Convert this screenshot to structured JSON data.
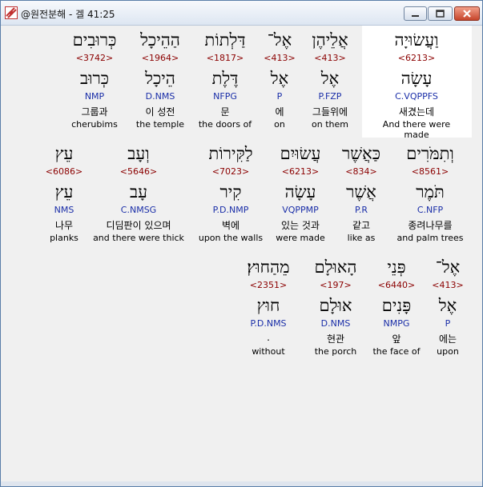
{
  "window": {
    "title": "@원전분해 - 겔 41:25"
  },
  "rows": [
    [
      {
        "heb": "וַעֲשׂוּיָה",
        "strong": "<6213>",
        "lemma": "עָשָׂה",
        "parse": "C.VQPPFS",
        "kor": "새겼는데",
        "eng": "And there were made"
      },
      {
        "heb": "אֲלֵיהֶן",
        "strong": "<413>",
        "lemma": "אֶל",
        "parse": "P.FZP",
        "kor": "그들위에",
        "eng": "on them"
      },
      {
        "heb": "אֶל־",
        "strong": "<413>",
        "lemma": "אֶל",
        "parse": "P",
        "kor": "에",
        "eng": "on"
      },
      {
        "heb": "דַּלְתוֹת",
        "strong": "<1817>",
        "lemma": "דֶּלֶת",
        "parse": "NFPG",
        "kor": "문",
        "eng": "the doors of"
      },
      {
        "heb": "הַהֵיכָל",
        "strong": "<1964>",
        "lemma": "הֵיכָל",
        "parse": "D.NMS",
        "kor": "이 성전",
        "eng": "the temple"
      },
      {
        "heb": "כְּרוּבִים",
        "strong": "<3742>",
        "lemma": "כְּרוּב",
        "parse": "NMP",
        "kor": "그룹과",
        "eng": "cherubims"
      }
    ],
    [
      {
        "heb": "וְתִמֹּרִים",
        "strong": "<8561>",
        "lemma": "תֹּמֶר",
        "parse": "C.NFP",
        "kor": "종려나무를",
        "eng": "and palm trees"
      },
      {
        "heb": "כַּאֲשֶׁר",
        "strong": "<834>",
        "lemma": "אֲשֶׁר",
        "parse": "P.R",
        "kor": "같고",
        "eng": "like as"
      },
      {
        "heb": "עֲשׂוּיִם",
        "strong": "<6213>",
        "lemma": "עָשָׂה",
        "parse": "VQPPMP",
        "kor": "있는 것과",
        "eng": "were made"
      },
      {
        "heb": "לַקִּירוֹת",
        "strong": "<7023>",
        "lemma": "קִיר",
        "parse": "P.D.NMP",
        "kor": "벽에",
        "eng": "upon the walls"
      },
      {
        "heb": "וְעָב",
        "strong": "<5646>",
        "lemma": "עָב",
        "parse": "C.NMSG",
        "kor": "디딤판이 있으며",
        "eng": "and there were thick"
      },
      {
        "heb": "עֵץ",
        "strong": "<6086>",
        "lemma": "עֵץ",
        "parse": "NMS",
        "kor": "나무",
        "eng": "planks"
      }
    ],
    [
      {
        "heb": "אֶל־",
        "strong": "<413>",
        "lemma": "אֶל",
        "parse": "P",
        "kor": "에는",
        "eng": "upon"
      },
      {
        "heb": "פְּנֵי",
        "strong": "<6440>",
        "lemma": "פָּנִים",
        "parse": "NMPG",
        "kor": "앞",
        "eng": "the face of"
      },
      {
        "heb": "הָאוּלָם",
        "strong": "<197>",
        "lemma": "אוּלָם",
        "parse": "D.NMS",
        "kor": "현관",
        "eng": "the porch"
      },
      {
        "heb": "מֵהַחוּץ׃",
        "strong": "<2351>",
        "lemma": "חוּץ",
        "parse": "P.D.NMS",
        "kor": ".",
        "eng": "without"
      }
    ]
  ],
  "colors": {
    "strong": "#8b0000",
    "parse": "#1a2ea8",
    "highlight": "#ffffff"
  }
}
